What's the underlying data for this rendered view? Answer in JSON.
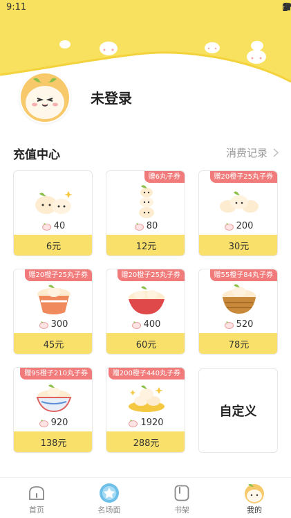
{
  "status_bar": {
    "time": "9:11"
  },
  "profile": {
    "login_status": "未登录"
  },
  "recharge": {
    "title": "充值中心",
    "records_link": "消费记录",
    "packages": [
      {
        "badge": "",
        "coins": "40",
        "price": "6元"
      },
      {
        "badge": "赠6丸子券",
        "coins": "80",
        "price": "12元"
      },
      {
        "badge": "赠20橙子25丸子券",
        "coins": "200",
        "price": "30元"
      },
      {
        "badge": "赠20橙子25丸子券",
        "coins": "300",
        "price": "45元"
      },
      {
        "badge": "赠20橙子25丸子券",
        "coins": "400",
        "price": "60元"
      },
      {
        "badge": "赠55橙子84丸子券",
        "coins": "520",
        "price": "78元"
      },
      {
        "badge": "赠95橙子210丸子券",
        "coins": "920",
        "price": "138元"
      },
      {
        "badge": "赠200橙子440丸子券",
        "coins": "1920",
        "price": "288元"
      }
    ],
    "custom_label": "自定义"
  },
  "nav": {
    "items": [
      {
        "label": "首页"
      },
      {
        "label": "名场面"
      },
      {
        "label": "书架"
      },
      {
        "label": "我的"
      }
    ],
    "active": "我的"
  },
  "colors": {
    "accent": "#f8e06a",
    "badge": "#f17b7b",
    "header": "#f7e15f"
  }
}
